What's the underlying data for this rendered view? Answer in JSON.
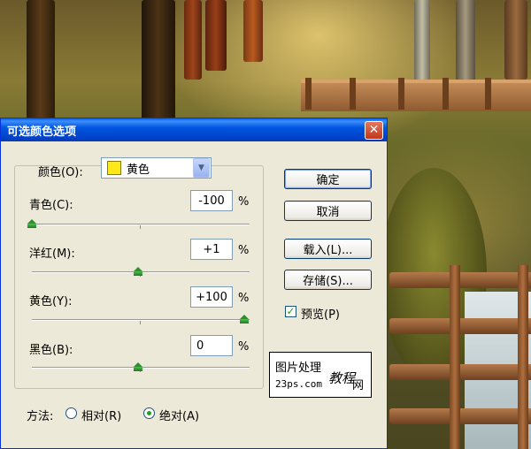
{
  "dialog": {
    "title": "可选颜色选项",
    "close_glyph": "✕",
    "colors_label": "颜色(O):",
    "colors_value": "黄色",
    "swatch_color": "#ffe81a",
    "sliders": [
      {
        "label": "青色(C):",
        "value": "-100",
        "unit": "%",
        "position_fraction": 0.0
      },
      {
        "label": "洋红(M):",
        "value": "+1",
        "unit": "%",
        "position_fraction": 0.5
      },
      {
        "label": "黄色(Y):",
        "value": "+100",
        "unit": "%",
        "position_fraction": 1.0
      },
      {
        "label": "黑色(B):",
        "value": "0",
        "unit": "%",
        "position_fraction": 0.5
      }
    ],
    "buttons": {
      "ok": "确定",
      "cancel": "取消",
      "load": "载入(L)...",
      "save": "存储(S)..."
    },
    "preview": {
      "label": "预览(P)",
      "checked": true
    },
    "method": {
      "label": "方法:",
      "options": [
        {
          "label": "相对(R)",
          "selected": false
        },
        {
          "label": "绝对(A)",
          "selected": true
        }
      ]
    }
  },
  "watermark": {
    "line1": "图片处理",
    "line2": "23ps.com",
    "script": "教程",
    "suffix": "网"
  },
  "icons": {
    "close": "close-icon",
    "dropdown": "chevron-down-icon",
    "check": "checkmark-icon"
  }
}
